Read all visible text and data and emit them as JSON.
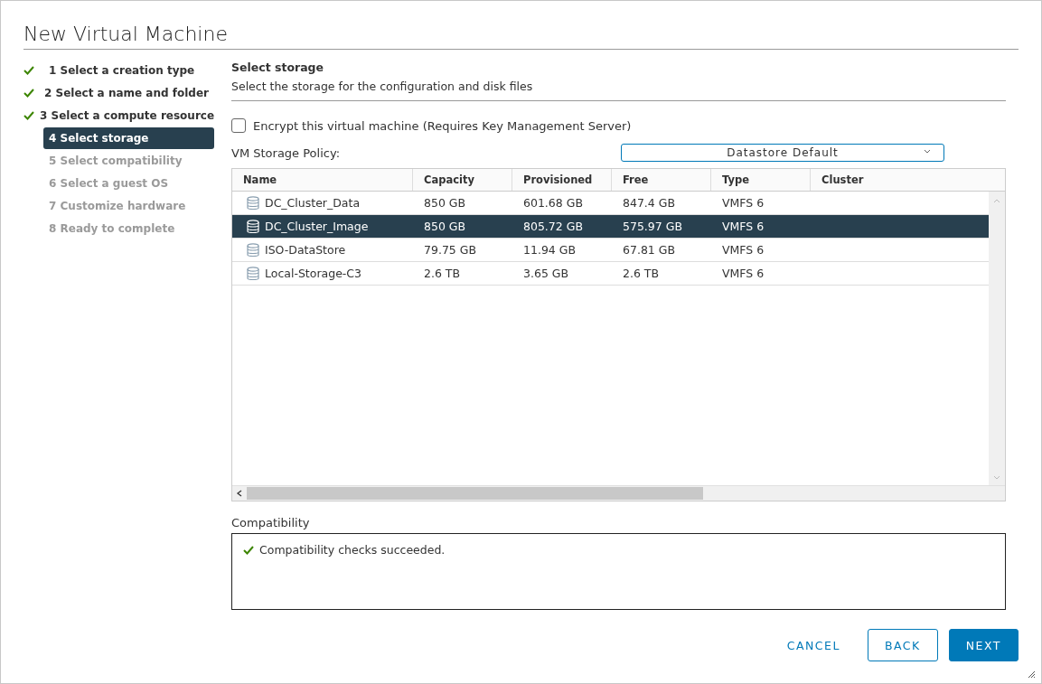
{
  "dialog": {
    "title": "New Virtual Machine"
  },
  "steps": [
    {
      "label": "1 Select a creation type",
      "done": true,
      "selected": false,
      "disabled": false
    },
    {
      "label": "2 Select a name and folder",
      "done": true,
      "selected": false,
      "disabled": false
    },
    {
      "label": "3 Select a compute resource",
      "done": true,
      "selected": false,
      "disabled": false
    },
    {
      "label": "4 Select storage",
      "done": false,
      "selected": true,
      "disabled": false
    },
    {
      "label": "5 Select compatibility",
      "done": false,
      "selected": false,
      "disabled": true
    },
    {
      "label": "6 Select a guest OS",
      "done": false,
      "selected": false,
      "disabled": true
    },
    {
      "label": "7 Customize hardware",
      "done": false,
      "selected": false,
      "disabled": true
    },
    {
      "label": "8 Ready to complete",
      "done": false,
      "selected": false,
      "disabled": true
    }
  ],
  "page": {
    "heading": "Select storage",
    "description": "Select the storage for the configuration and disk files"
  },
  "encrypt": {
    "label": "Encrypt this virtual machine (Requires Key Management Server)",
    "checked": false
  },
  "policy": {
    "label": "VM Storage Policy:",
    "value": "Datastore Default"
  },
  "table": {
    "columns": [
      "Name",
      "Capacity",
      "Provisioned",
      "Free",
      "Type",
      "Cluster"
    ],
    "rows": [
      {
        "selected": false,
        "cells": [
          "DC_Cluster_Data",
          "850 GB",
          "601.68 GB",
          "847.4 GB",
          "VMFS 6",
          ""
        ]
      },
      {
        "selected": true,
        "cells": [
          "DC_Cluster_Image",
          "850 GB",
          "805.72 GB",
          "575.97 GB",
          "VMFS 6",
          ""
        ]
      },
      {
        "selected": false,
        "cells": [
          "ISO-DataStore",
          "79.75 GB",
          "11.94 GB",
          "67.81 GB",
          "VMFS 6",
          ""
        ]
      },
      {
        "selected": false,
        "cells": [
          "Local-Storage-C3",
          "2.6 TB",
          "3.65 GB",
          "2.6 TB",
          "VMFS 6",
          ""
        ]
      }
    ]
  },
  "compatibility": {
    "label": "Compatibility",
    "message": "Compatibility checks succeeded."
  },
  "buttons": [
    {
      "label": "CANCEL",
      "kind": "flat"
    },
    {
      "label": "BACK",
      "kind": "outline"
    },
    {
      "label": "NEXT",
      "kind": "primary"
    }
  ]
}
